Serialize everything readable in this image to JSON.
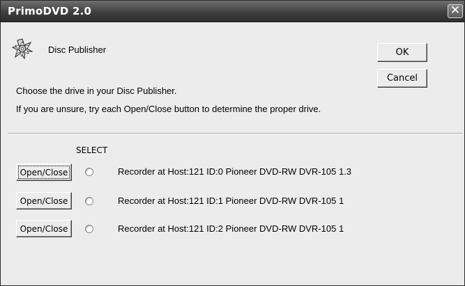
{
  "window": {
    "title": "PrimoDVD 2.0",
    "close_glyph": "✕"
  },
  "header": {
    "icon": "disc-publisher-icon",
    "app_name": "Disc Publisher"
  },
  "buttons": {
    "ok": "OK",
    "cancel": "Cancel"
  },
  "instructions": {
    "line1": "Choose the drive in your Disc Publisher.",
    "line2": "If you are unsure, try each Open/Close button to determine the proper drive."
  },
  "drive_list": {
    "select_header": "SELECT",
    "drives": [
      {
        "button": "Open/Close",
        "label": "Recorder at Host:121 ID:0  Pioneer DVD-RW DVR-105 1.3",
        "selected": false
      },
      {
        "button": "Open/Close",
        "label": "Recorder at Host:121 ID:1  Pioneer DVD-RW DVR-105 1",
        "selected": false
      },
      {
        "button": "Open/Close",
        "label": "Recorder at Host:121 ID:2  Pioneer DVD-RW DVR-105 1",
        "selected": false
      }
    ]
  }
}
